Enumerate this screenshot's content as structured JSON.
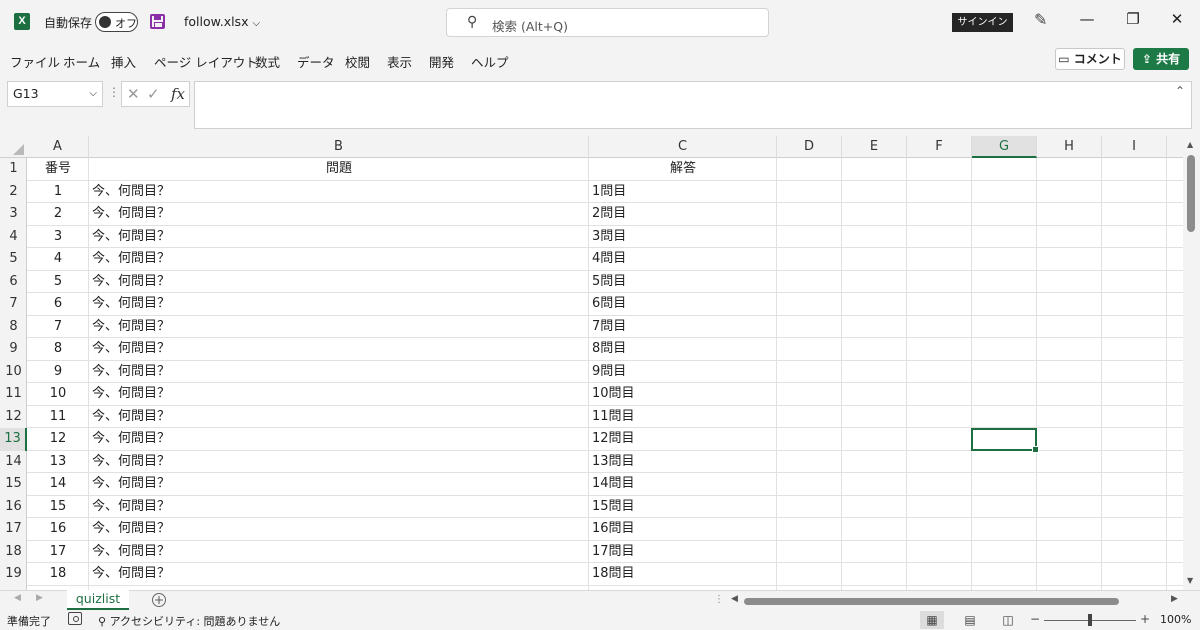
{
  "titlebar": {
    "app_icon": "X",
    "autosave_label": "自動保存",
    "autosave_state": "オフ",
    "filename": "follow.xlsx",
    "search_placeholder": "検索 (Alt+Q)",
    "signin_label": "サインイン",
    "window_controls": [
      "minimize-icon",
      "restore-icon",
      "close-icon"
    ]
  },
  "menu": {
    "items": [
      "ファイル",
      "ホーム",
      "挿入",
      "ページ レイアウト",
      "数式",
      "データ",
      "校閲",
      "表示",
      "開発",
      "ヘルプ"
    ],
    "comment_label": "コメント",
    "share_label": "共有"
  },
  "formula_bar": {
    "name_box": "G13",
    "formula": ""
  },
  "grid": {
    "columns": [
      "A",
      "B",
      "C",
      "D",
      "E",
      "F",
      "G",
      "H",
      "I"
    ],
    "selected_column": "G",
    "selected_row": 13,
    "row_numbers": [
      "1",
      "2",
      "3",
      "4",
      "5",
      "6",
      "7",
      "8",
      "9",
      "10",
      "11",
      "12",
      "13",
      "14",
      "15",
      "16",
      "17",
      "18",
      "19"
    ],
    "header_row": [
      "番号",
      "問題",
      "解答"
    ],
    "rows": [
      [
        "1",
        "今、何問目？",
        "1問目"
      ],
      [
        "2",
        "今、何問目？",
        "2問目"
      ],
      [
        "3",
        "今、何問目？",
        "3問目"
      ],
      [
        "4",
        "今、何問目？",
        "4問目"
      ],
      [
        "5",
        "今、何問目？",
        "5問目"
      ],
      [
        "6",
        "今、何問目？",
        "6問目"
      ],
      [
        "7",
        "今、何問目？",
        "7問目"
      ],
      [
        "8",
        "今、何問目？",
        "8問目"
      ],
      [
        "9",
        "今、何問目？",
        "9問目"
      ],
      [
        "10",
        "今、何問目？",
        "10問目"
      ],
      [
        "11",
        "今、何問目？",
        "11問目"
      ],
      [
        "12",
        "今、何問目？",
        "12問目"
      ],
      [
        "13",
        "今、何問目？",
        "13問目"
      ],
      [
        "14",
        "今、何問目？",
        "14問目"
      ],
      [
        "15",
        "今、何問目？",
        "15問目"
      ],
      [
        "16",
        "今、何問目？",
        "16問目"
      ],
      [
        "17",
        "今、何問目？",
        "17問目"
      ],
      [
        "18",
        "今、何問目？",
        "18問目"
      ]
    ]
  },
  "sheets": {
    "tabs": [
      "quizlist"
    ],
    "active": "quizlist"
  },
  "status": {
    "ready": "準備完了",
    "accessibility": "アクセシビリティ: 問題ありません",
    "zoom": "100%"
  },
  "colors": {
    "accent": "#1d6f42",
    "chrome": "#f3f3f3",
    "share": "#1d7a46"
  }
}
